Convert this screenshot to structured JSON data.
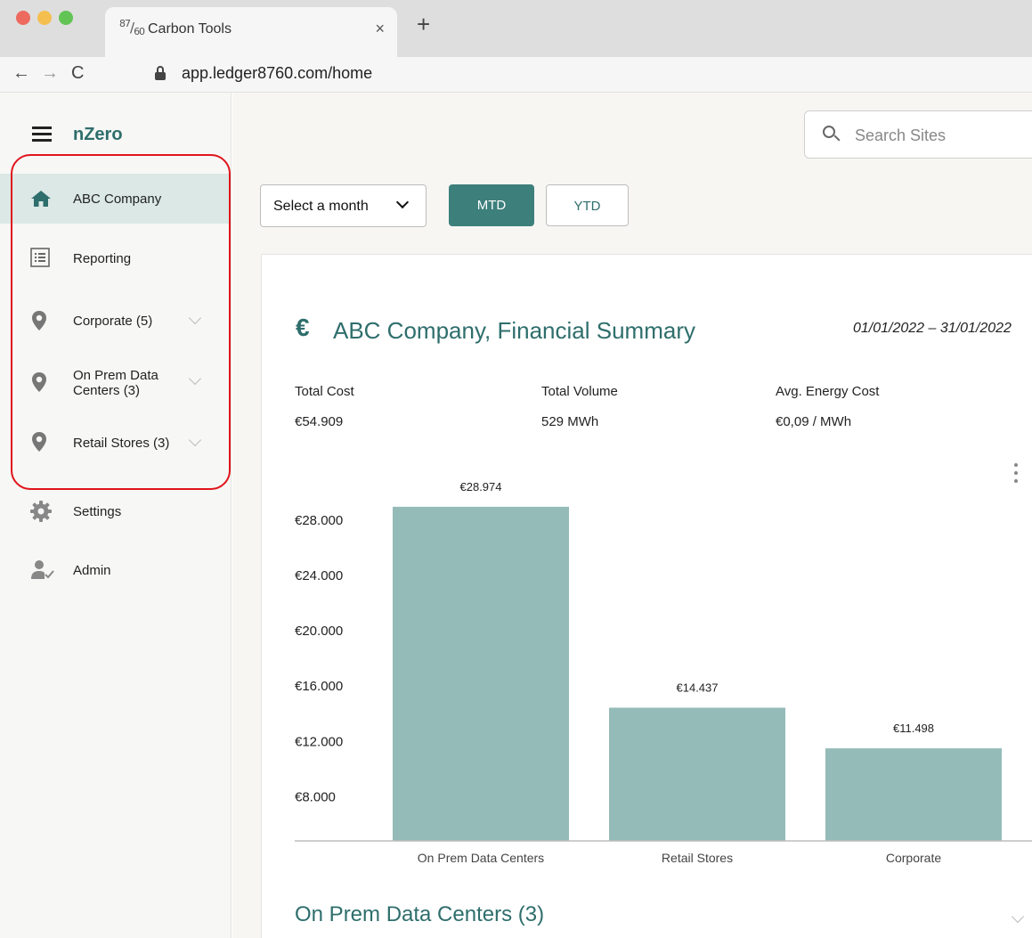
{
  "browser": {
    "tab_logo_top": "87",
    "tab_logo_bottom": "60",
    "tab_title": "Carbon Tools",
    "tab_close": "×",
    "new_tab": "+",
    "url": "app.ledger8760.com/home",
    "back": "←",
    "forward": "→",
    "reload": "C"
  },
  "sidebar": {
    "brand": "nZero",
    "items": [
      {
        "label": "ABC Company",
        "icon": "home-icon",
        "active": true
      },
      {
        "label": "Reporting",
        "icon": "report-icon"
      },
      {
        "label": "Corporate (5)",
        "icon": "location-pin-icon",
        "expandable": true
      },
      {
        "label": "On Prem Data Centers (3)",
        "icon": "location-pin-icon",
        "expandable": true
      },
      {
        "label": "Retail Stores (3)",
        "icon": "location-pin-icon",
        "expandable": true
      },
      {
        "label": "Settings",
        "icon": "gear-icon"
      },
      {
        "label": "Admin",
        "icon": "admin-user-icon"
      }
    ]
  },
  "header": {
    "search_placeholder": "Search Sites"
  },
  "filters": {
    "month_select": "Select a month",
    "mtd": "MTD",
    "ytd": "YTD"
  },
  "summary": {
    "title": "ABC Company, Financial Summary",
    "date_range": "01/01/2022 – 31/01/2022",
    "metrics": [
      {
        "label": "Total Cost",
        "value": "€54.909"
      },
      {
        "label": "Total Volume",
        "value": "529 MWh"
      },
      {
        "label": "Avg. Energy Cost",
        "value": "€0,09 / MWh"
      }
    ]
  },
  "chart_data": {
    "type": "bar",
    "categories": [
      "On Prem Data Centers",
      "Retail Stores",
      "Corporate"
    ],
    "values": [
      28974,
      14437,
      11498
    ],
    "data_labels": [
      "€28.974",
      "€14.437",
      "€11.498"
    ],
    "ytick_values": [
      8000,
      12000,
      16000,
      20000,
      24000,
      28000
    ],
    "ytick_labels": [
      "€8.000",
      "€12.000",
      "€16.000",
      "€20.000",
      "€24.000",
      "€28.000"
    ],
    "ylim": [
      4800,
      30000
    ],
    "grid": false,
    "bar_color": "#94bbb8"
  },
  "section": {
    "title": "On Prem Data Centers (3)"
  },
  "colors": {
    "accent": "#2e6e6c",
    "button_primary": "#3d7f7b",
    "active_nav_bg": "#dbe8e5",
    "highlight_outline": "#e0141b"
  }
}
